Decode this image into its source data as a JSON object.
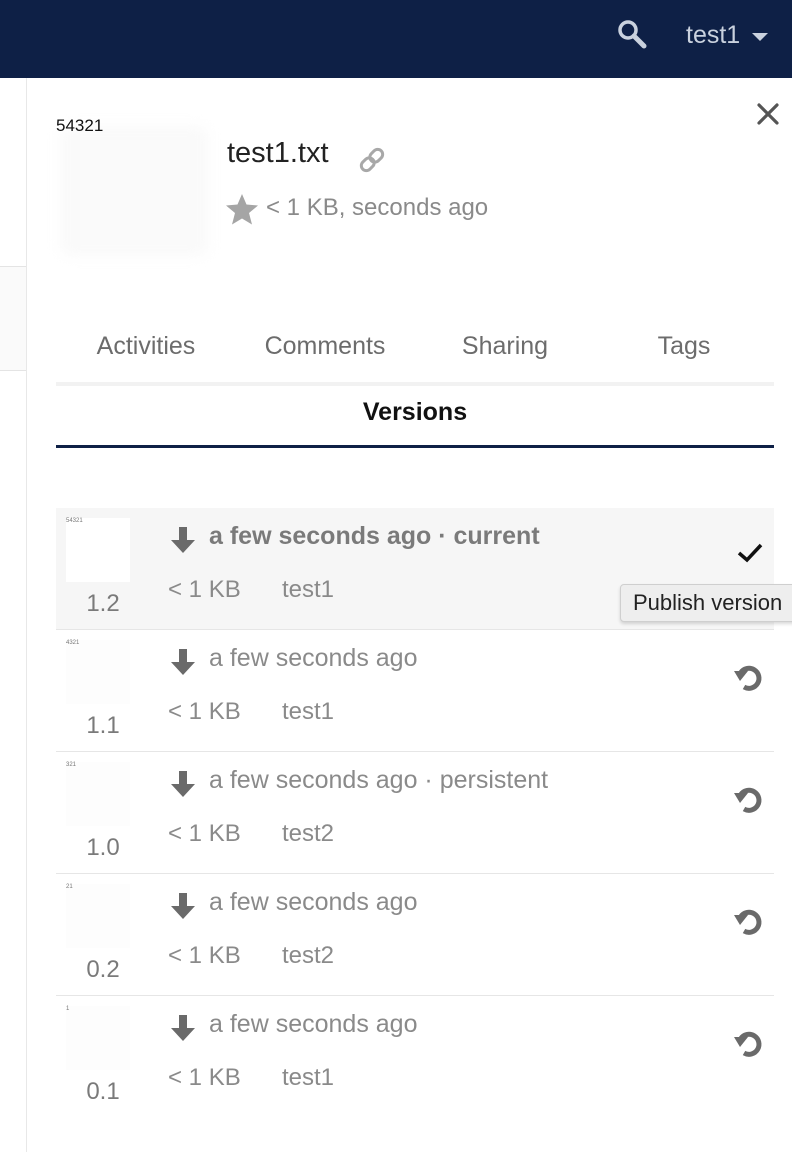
{
  "header": {
    "user_name": "test1",
    "search_icon": "search-icon",
    "user_menu_icon": "chevron-down-icon",
    "background_color": "#0e2046"
  },
  "sidebar": {
    "thumbnail_text": "54321",
    "file_name": "test1.txt",
    "file_meta": "< 1 KB, seconds ago",
    "link_icon": "link-icon",
    "star_icon": "star-icon",
    "close_icon": "close-icon"
  },
  "tabs": {
    "activities": "Activities",
    "comments": "Comments",
    "sharing": "Sharing",
    "tags": "Tags",
    "versions": "Versions"
  },
  "versions": [
    {
      "thumb": "54321",
      "version": "1.2",
      "time": "a few seconds ago · current",
      "size": "< 1 KB",
      "user": "test1",
      "current": true
    },
    {
      "thumb": "4321",
      "version": "1.1",
      "time": "a few seconds ago",
      "size": "< 1 KB",
      "user": "test1",
      "current": false
    },
    {
      "thumb": "321",
      "version": "1.0",
      "time": "a few seconds ago · persistent",
      "size": "< 1 KB",
      "user": "test2",
      "current": false
    },
    {
      "thumb": "21",
      "version": "0.2",
      "time": "a few seconds ago",
      "size": "< 1 KB",
      "user": "test2",
      "current": false
    },
    {
      "thumb": "1",
      "version": "0.1",
      "time": "a few seconds ago",
      "size": "< 1 KB",
      "user": "test1",
      "current": false
    }
  ],
  "tooltip": {
    "text": "Publish version"
  }
}
